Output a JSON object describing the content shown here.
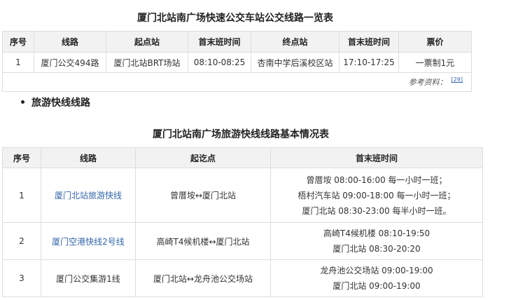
{
  "table1": {
    "caption": "厦门北站南广场快速公交车站公交线路一览表",
    "headers": [
      "序号",
      "线路",
      "起点站",
      "首末班时间",
      "终点站",
      "首末班时间",
      "票价"
    ],
    "rows": [
      [
        "1",
        "厦门公交494路",
        "厦门北站BRT场站",
        "08:10-08:25",
        "杏南中学后溪校区站",
        "17:10-17:25",
        "一票制1元"
      ]
    ],
    "reference_label": "参考资料：",
    "reference_ref": "[29]"
  },
  "bullet_text": "旅游快线线路",
  "table2": {
    "caption": "厦门北站南广场旅游快线线路基本情况表",
    "headers": [
      "序号",
      "线路",
      "起讫点",
      "首末班时间"
    ],
    "rows": [
      {
        "no": "1",
        "route": "厦门北站旅游快线",
        "route_is_link": true,
        "endpoints": "曾厝垵↔厦门北站",
        "times": [
          "曾厝垵 08:00-16:00 每一小时一班；",
          "梧村汽车站 09:00-18:00 每一小时一班；",
          "厦门北站 08:30-23:00 每半小时一班。"
        ]
      },
      {
        "no": "2",
        "route": "厦门空港快线2号线",
        "route_is_link": true,
        "endpoints": "高崎T4候机楼↔厦门北站",
        "times": [
          "高崎T4候机楼 08:10-19:50",
          "厦门北站 08:30-20:20"
        ]
      },
      {
        "no": "3",
        "route": "厦门公交集游1线",
        "route_is_link": false,
        "endpoints": "厦门北站↔龙舟池公交场站",
        "times": [
          "龙舟池公交场站 09:00-19:00",
          "厦门北站 09:00-19:00"
        ]
      }
    ]
  },
  "colors": {
    "header_bg": "#f2f2f2",
    "border": "#dddddd",
    "link": "#3366aa"
  }
}
